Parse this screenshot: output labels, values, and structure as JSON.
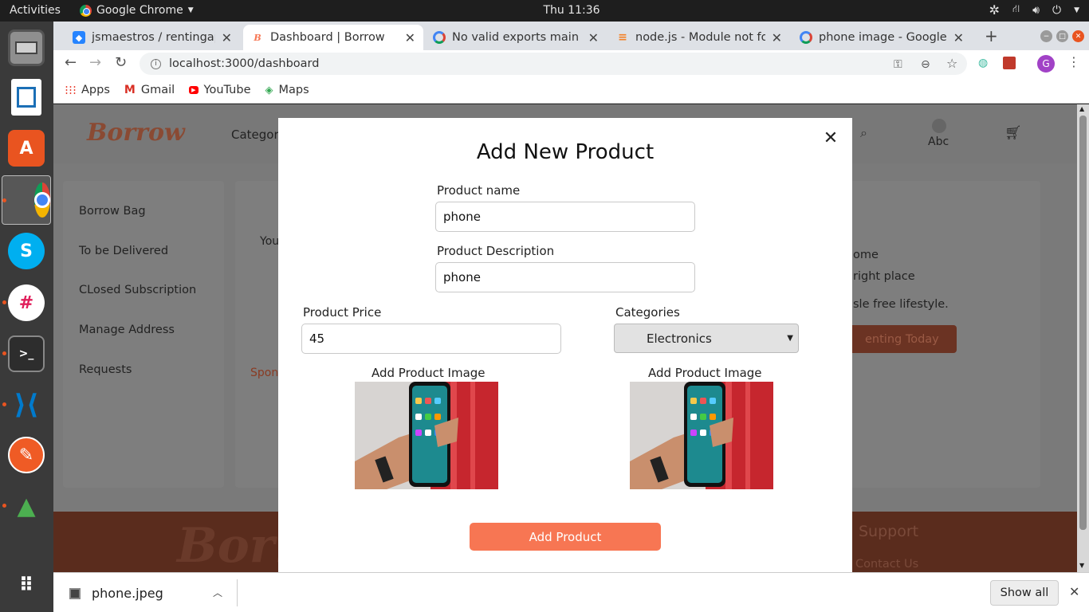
{
  "system": {
    "activities": "Activities",
    "app_name": "Google Chrome",
    "clock": "Thu 11:36"
  },
  "dock": {
    "items": [
      "files-icon",
      "writer-icon",
      "software-icon",
      "chrome-icon",
      "skype-icon",
      "slack-icon",
      "terminal-icon",
      "vscode-icon",
      "postman-icon",
      "robo3t-icon",
      "apps-grid-icon"
    ]
  },
  "browser": {
    "tabs": [
      {
        "title": "jsmaestros / rentingapp",
        "icon": "bitbucket-icon"
      },
      {
        "title": "Dashboard | Borrow",
        "icon": "borrow-icon"
      },
      {
        "title": "No valid exports main fo",
        "icon": "google-icon"
      },
      {
        "title": "node.js - Module not fou",
        "icon": "stackoverflow-icon"
      },
      {
        "title": "phone image - Google Se",
        "icon": "google-icon"
      }
    ],
    "url_host": "localhost",
    "url_rest": ":3000/dashboard",
    "profile_initial": "G",
    "bookmarks": [
      "Apps",
      "Gmail",
      "YouTube",
      "Maps"
    ]
  },
  "page": {
    "logo": "Borrow",
    "nav_categories": "Categor",
    "user_name": "Abc",
    "sidebar": [
      "Borrow Bag",
      "To be Delivered",
      "CLosed Subscription",
      "Manage Address",
      "Requests"
    ],
    "main_partial_left": "You",
    "main_partial_sponsor": "Spon",
    "main_partial_right": [
      "ome",
      "right place",
      "sle free lifestyle."
    ],
    "main_cta": "enting Today",
    "footer_logo": "Borro",
    "footer_support": "Support",
    "footer_contact": "Contact Us"
  },
  "modal": {
    "title": "Add New Product",
    "product_name_label": "Product name",
    "product_name_value": "phone",
    "product_desc_label": "Product Description",
    "product_desc_value": "phone",
    "price_label": "Product Price",
    "price_value": "45",
    "categories_label": "Categories",
    "category_selected": "Electronics",
    "image_label_1": "Add Product Image",
    "image_label_2": "Add Product Image",
    "submit_label": "Add Product"
  },
  "downloads": {
    "file_name": "phone.jpeg",
    "show_all": "Show all"
  },
  "colors": {
    "accent": "#f77653",
    "footer": "#5a2c1d",
    "logo": "#8a4a33"
  }
}
